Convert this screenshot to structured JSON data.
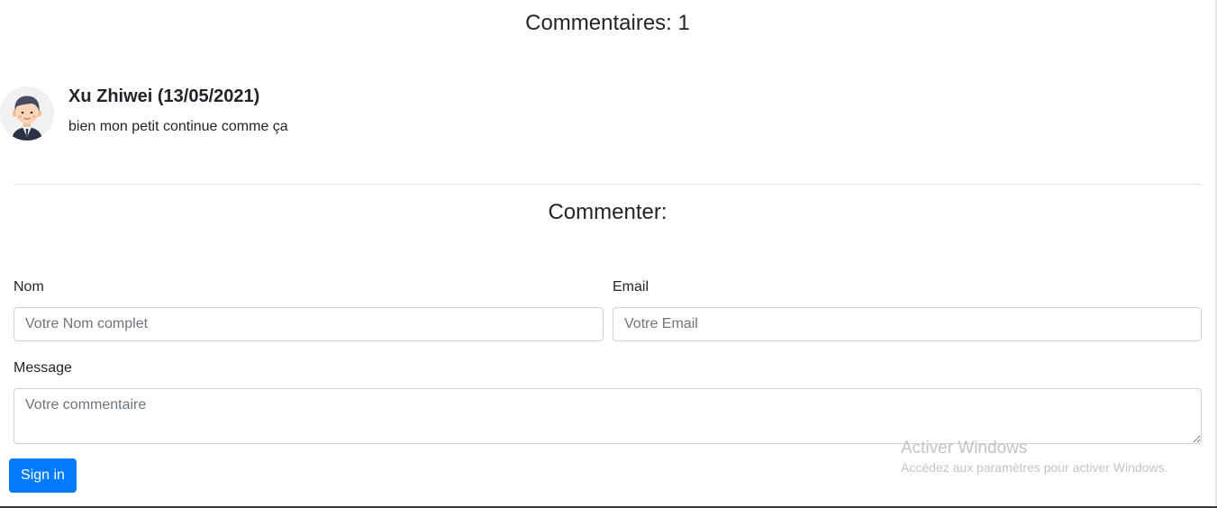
{
  "comments_section": {
    "heading": "Commentaires: 1",
    "comments": [
      {
        "author_line": "Xu Zhiwei (13/05/2021)",
        "text": "bien mon petit continue comme ça",
        "avatar_icon": "user-avatar-icon"
      }
    ]
  },
  "comment_form": {
    "heading": "Commenter:",
    "name": {
      "label": "Nom",
      "placeholder": "Votre Nom complet",
      "value": ""
    },
    "email": {
      "label": "Email",
      "placeholder": "Votre Email",
      "value": ""
    },
    "message": {
      "label": "Message",
      "placeholder": "Votre commentaire",
      "value": ""
    },
    "submit_label": "Sign in"
  },
  "watermark": {
    "title": "Activer Windows",
    "subtitle": "Accédez aux paramètres pour activer Windows."
  },
  "colors": {
    "primary": "#007bff",
    "text": "#212529",
    "border": "#ced4da",
    "divider": "#dee2e6",
    "placeholder": "#6c757d",
    "watermark": "#c4c4c4"
  }
}
